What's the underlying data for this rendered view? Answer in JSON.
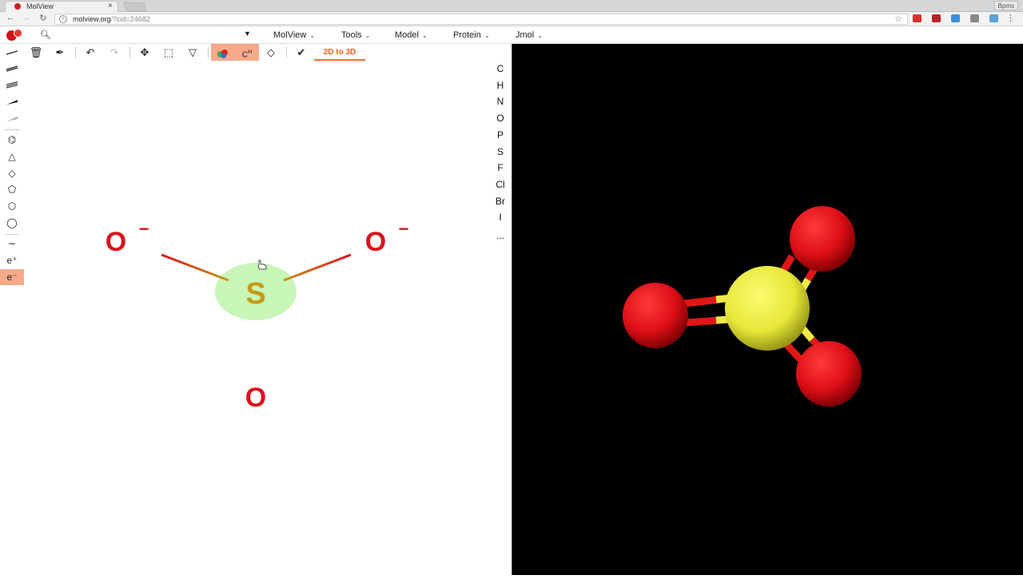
{
  "browser": {
    "tab_title": "MolView",
    "tab_close": "×",
    "user_badge": "Bpms",
    "url_domain": "molview.org",
    "url_query": "/?cid=24682",
    "menu_icon": "⋮"
  },
  "app": {
    "menus": [
      "MolView",
      "Tools",
      "Model",
      "Protein",
      "Jmol"
    ],
    "convert_button": "2D to 3D"
  },
  "left_tools": {
    "charge_plus": "e⁺",
    "charge_minus": "e⁻"
  },
  "elements": [
    "C",
    "H",
    "N",
    "O",
    "P",
    "S",
    "F",
    "Cl",
    "Br",
    "I",
    "..."
  ],
  "molecule_2d": {
    "center_atom": "S",
    "top_left_atom": "O",
    "top_left_charge": "−",
    "top_right_atom": "O",
    "top_right_charge": "−",
    "bottom_atom": "O"
  },
  "colors": {
    "oxygen": "#d9131c",
    "sulfur": "#c69a17",
    "highlight": "#c8f5b8",
    "accent": "#ff5a14",
    "active_tool": "#f7a989"
  }
}
